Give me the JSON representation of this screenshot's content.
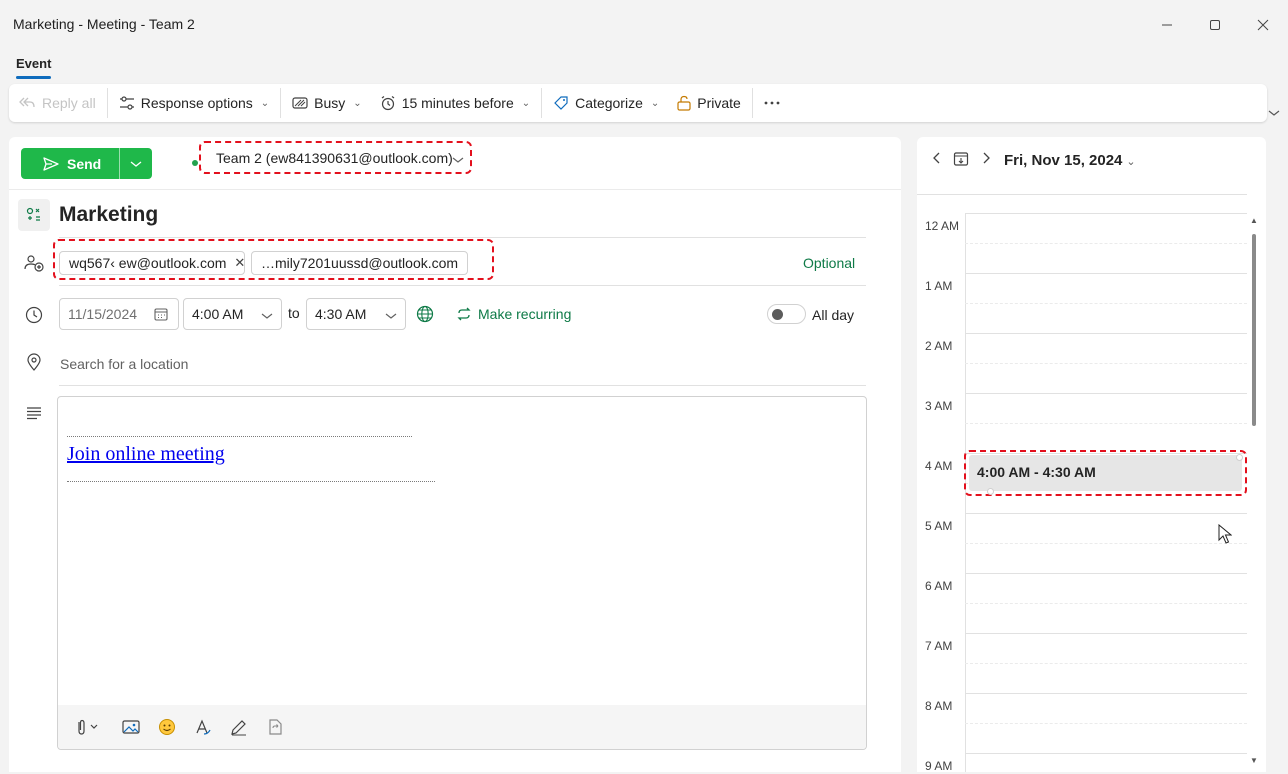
{
  "window": {
    "title": "Marketing - Meeting - Team 2"
  },
  "tabs": {
    "active": "Event"
  },
  "ribbon": {
    "reply_all": "Reply all",
    "response_options": "Response options",
    "busy": "Busy",
    "reminder": "15 minutes before",
    "categorize": "Categorize",
    "private": "Private"
  },
  "compose": {
    "send_label": "Send",
    "from_account": "Team 2 (ew841390631@outlook.com)",
    "subject": "Marketing",
    "attendees": [
      "wq567‹ ew@outlook.com",
      "…mily7201uussd@outlook.com"
    ],
    "optional_label": "Optional",
    "start_date": "11/15/2024",
    "start_time": "4:00 AM",
    "to_label": "to",
    "end_time": "4:30 AM",
    "make_recurring": "Make recurring",
    "all_day_label": "All day",
    "all_day": false,
    "location_placeholder": "Search for a location",
    "join_link": "Join online meeting"
  },
  "calendar": {
    "date_label": "Fri, Nov 15, 2024",
    "hours": [
      "12 AM",
      "1 AM",
      "2 AM",
      "3 AM",
      "4 AM",
      "5 AM",
      "6 AM",
      "7 AM",
      "8 AM",
      "9 AM"
    ],
    "event_time": "4:00 AM - 4:30 AM"
  },
  "colors": {
    "accent_green": "#1fb84a",
    "link_green": "#0e7a47",
    "highlight_dash": "#e3101d",
    "tab_underline": "#0f6cbd"
  }
}
